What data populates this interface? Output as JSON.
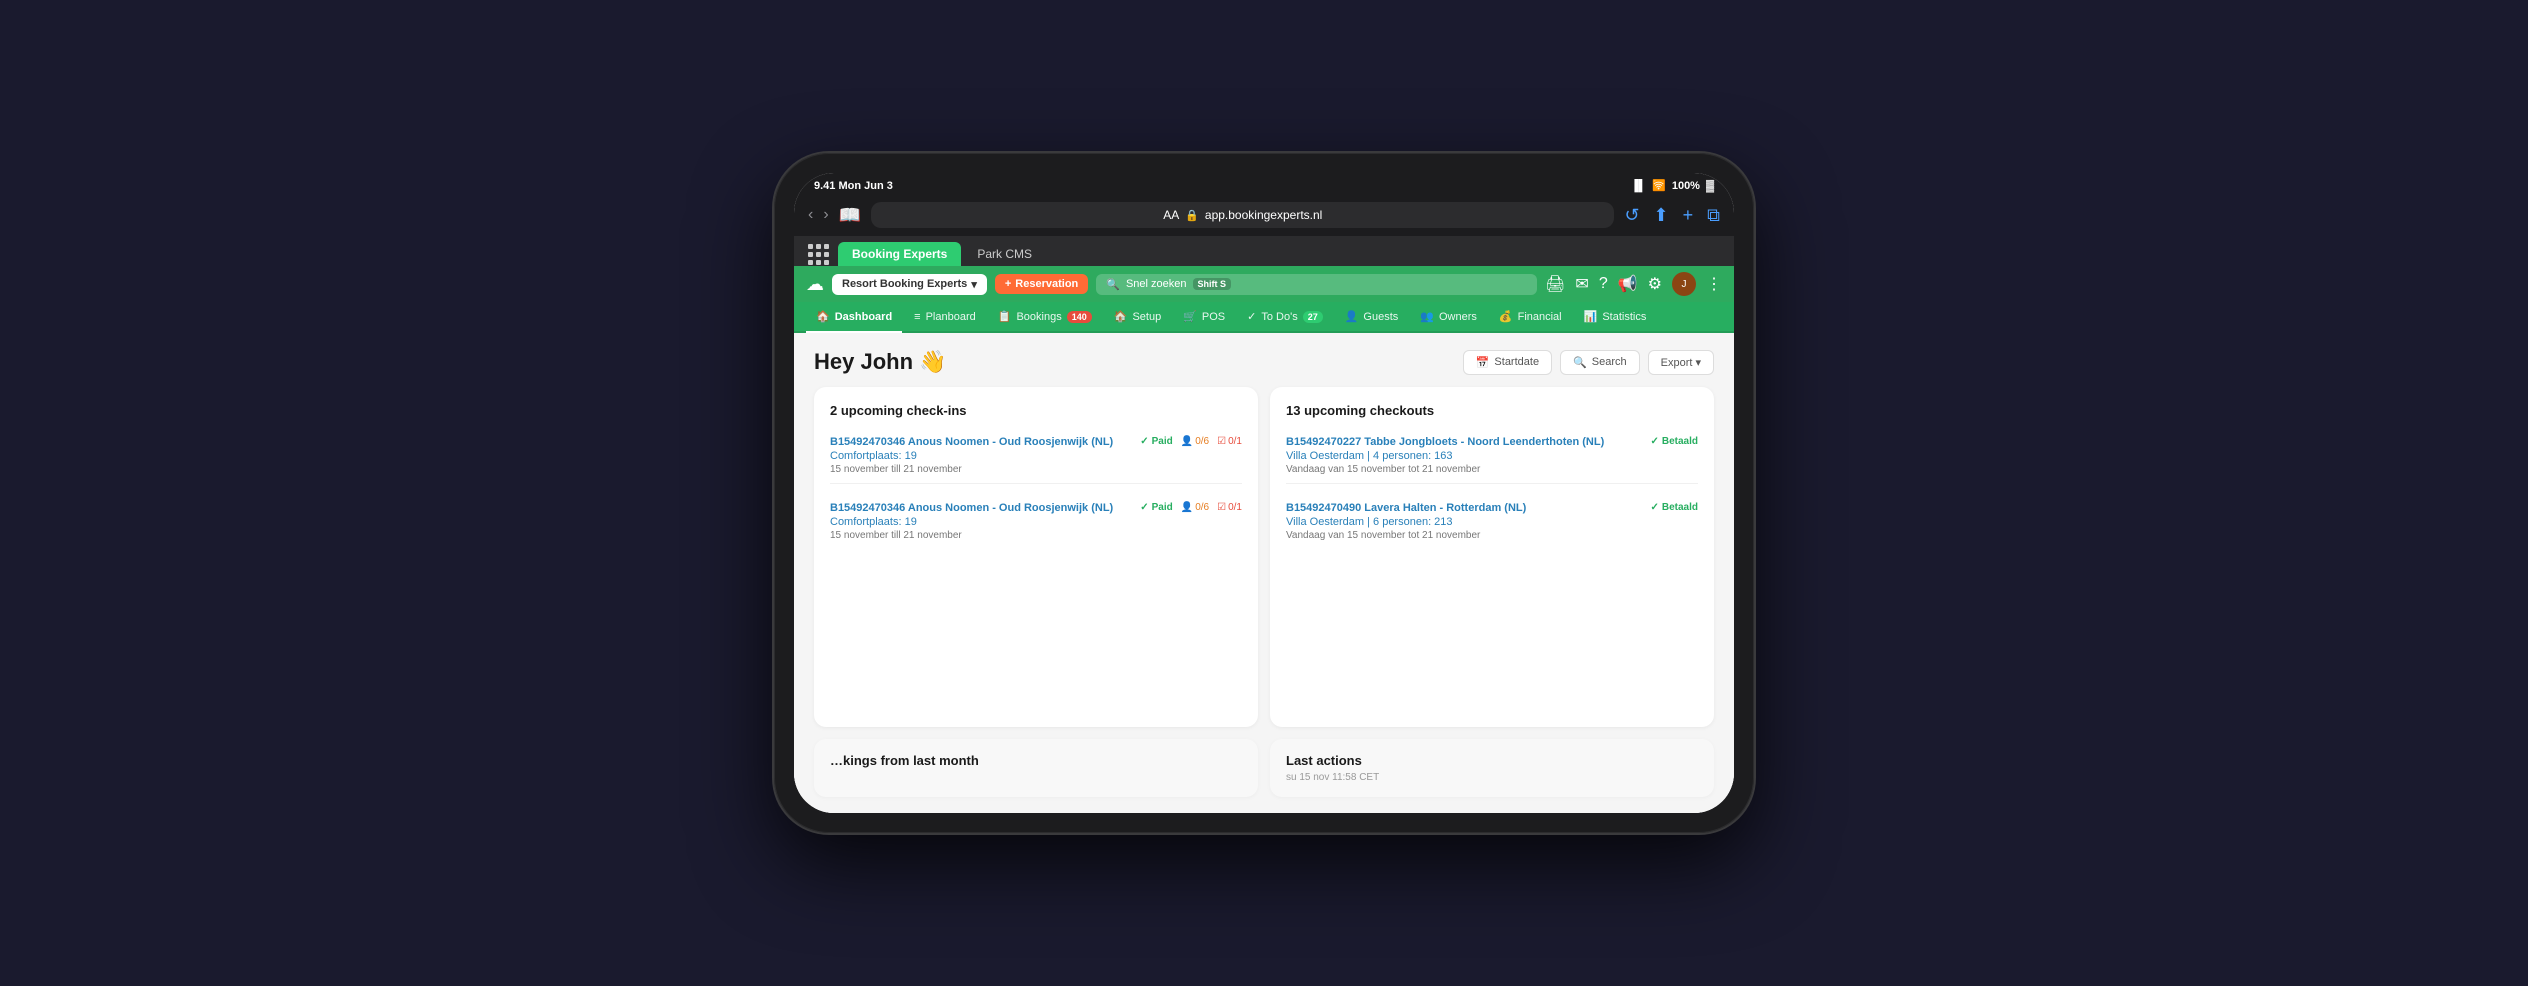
{
  "status_bar": {
    "time": "9.41 Mon Jun 3",
    "signal": "●●●●",
    "wifi": "WiFi",
    "battery": "100%"
  },
  "browser": {
    "url": "app.bookingexperts.nl",
    "aa_label": "AA",
    "tab1": "Booking Experts",
    "tab2": "Park CMS"
  },
  "topbar": {
    "brand": "Resort Booking Experts",
    "reservation_btn": "+ Reservation",
    "search_placeholder": "Snel zoeken",
    "shortcut": "Shift S"
  },
  "nav": {
    "items": [
      {
        "label": "Dashboard",
        "icon": "🏠",
        "active": true,
        "badge": null
      },
      {
        "label": "Planboard",
        "icon": "≡",
        "active": false,
        "badge": null
      },
      {
        "label": "Bookings",
        "icon": "📋",
        "active": false,
        "badge": "140"
      },
      {
        "label": "Setup",
        "icon": "🏠",
        "active": false,
        "badge": null
      },
      {
        "label": "POS",
        "icon": "🛒",
        "active": false,
        "badge": null
      },
      {
        "label": "To Do's",
        "icon": "✓",
        "active": false,
        "badge": "27"
      },
      {
        "label": "Guests",
        "icon": "👤",
        "active": false,
        "badge": null
      },
      {
        "label": "Owners",
        "icon": "👥",
        "active": false,
        "badge": null
      },
      {
        "label": "Financial",
        "icon": "💰",
        "active": false,
        "badge": null
      },
      {
        "label": "Statistics",
        "icon": "📊",
        "active": false,
        "badge": null
      }
    ]
  },
  "page": {
    "greeting": "Hey John 👋",
    "startdate_label": "Startdate",
    "search_label": "Search",
    "export_label": "Export ▾"
  },
  "checkins_card": {
    "title": "2 upcoming check-ins",
    "items": [
      {
        "link": "B15492470346 Anous Noomen - Oud Roosjenwijk (NL)",
        "subtitle": "Comfortplaats: 19",
        "date": "15 november till 21 november",
        "status": "Paid",
        "persons": "0/6",
        "tasks": "0/1"
      },
      {
        "link": "B15492470346 Anous Noomen - Oud Roosjenwijk (NL)",
        "subtitle": "Comfortplaats: 19",
        "date": "15 november till 21 november",
        "status": "Paid",
        "persons": "0/6",
        "tasks": "0/1"
      }
    ]
  },
  "checkouts_card": {
    "title": "13 upcoming checkouts",
    "items": [
      {
        "link": "B15492470227 Tabbe Jongbloets - Noord Leenderthoten (NL)",
        "subtitle": "Villa Oesterdam | 4 personen: 163",
        "date": "Vandaag van 15 november tot 21 november",
        "status": "Betaald"
      },
      {
        "link": "B15492470490 Lavera Halten - Rotterdam (NL)",
        "subtitle": "Villa Oesterdam | 6 personen: 213",
        "date": "Vandaag van 15 november tot 21 november",
        "status": "Betaald"
      }
    ]
  },
  "bottom": {
    "bookings_title": "kings from last month",
    "last_actions_title": "Last actions",
    "last_action_time": "su 15 nov 11:58 CET"
  }
}
